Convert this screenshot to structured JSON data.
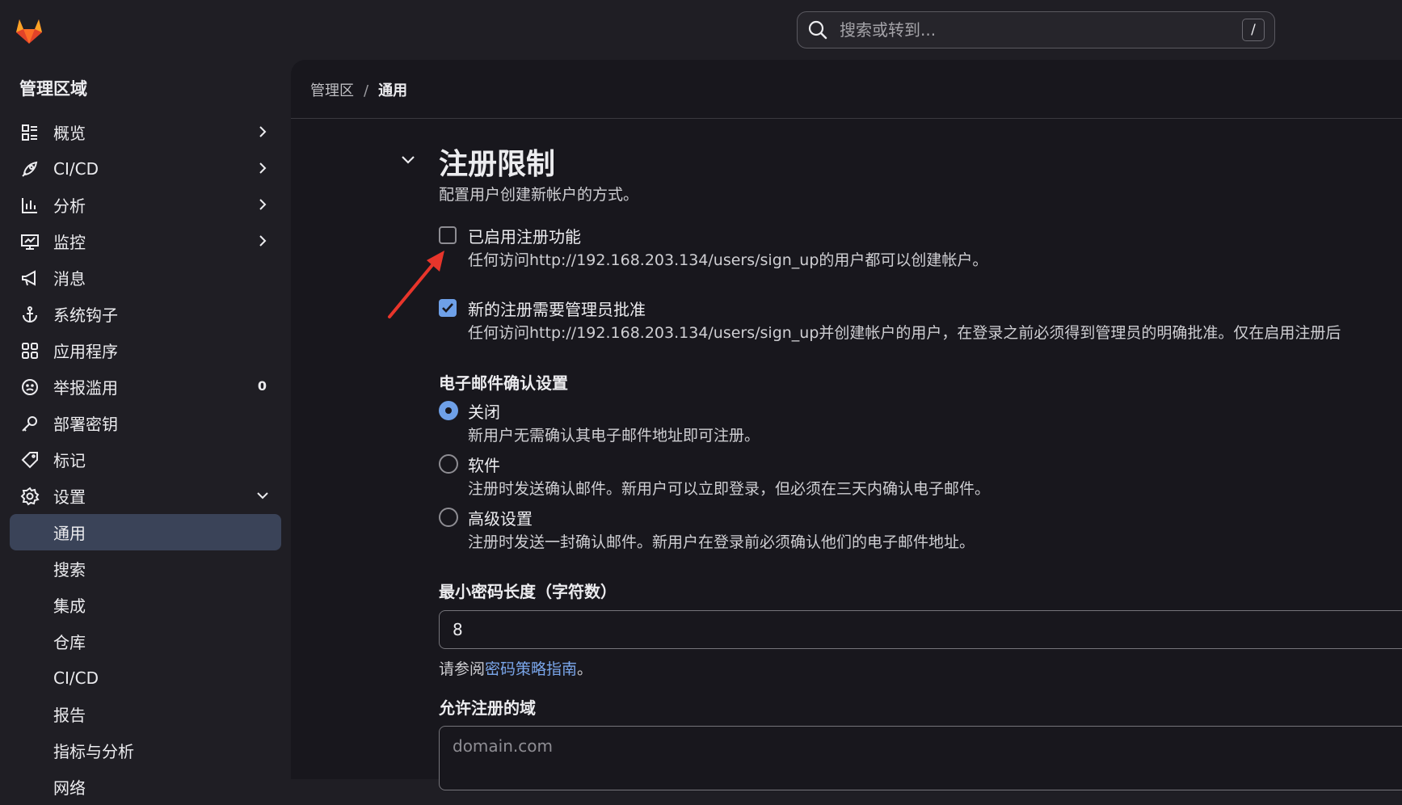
{
  "topbar": {
    "search_placeholder": "搜索或转到...",
    "search_shortcut": "/"
  },
  "sidebar": {
    "title": "管理区域",
    "items": [
      {
        "label": "概览",
        "icon": "overview-icon"
      },
      {
        "label": "CI/CD",
        "icon": "rocket-icon"
      },
      {
        "label": "分析",
        "icon": "chart-icon"
      },
      {
        "label": "监控",
        "icon": "monitor-icon"
      },
      {
        "label": "消息",
        "icon": "megaphone-icon"
      },
      {
        "label": "系统钩子",
        "icon": "anchor-icon"
      },
      {
        "label": "应用程序",
        "icon": "apps-icon"
      },
      {
        "label": "举报滥用",
        "icon": "abuse-icon",
        "count": "0"
      },
      {
        "label": "部署密钥",
        "icon": "key-icon"
      },
      {
        "label": "标记",
        "icon": "label-icon"
      },
      {
        "label": "设置",
        "icon": "gear-icon"
      }
    ],
    "subitems": [
      "通用",
      "搜索",
      "集成",
      "仓库",
      "CI/CD",
      "报告",
      "指标与分析",
      "网络"
    ]
  },
  "breadcrumb": {
    "root": "管理区",
    "separator": "/",
    "current": "通用"
  },
  "section": {
    "title": "注册限制",
    "description": "配置用户创建新帐户的方式。",
    "signup_enabled": {
      "label": "已启用注册功能",
      "help": "任何访问http://192.168.203.134/users/sign_up的用户都可以创建帐户。",
      "checked": false
    },
    "admin_approval": {
      "label": "新的注册需要管理员批准",
      "help": "任何访问http://192.168.203.134/users/sign_up并创建帐户的用户，在登录之前必须得到管理员的明确批准。仅在启用注册后",
      "checked": true
    },
    "email_confirm": {
      "heading": "电子邮件确认设置",
      "options": [
        {
          "label": "关闭",
          "help": "新用户无需确认其电子邮件地址即可注册。",
          "checked": true
        },
        {
          "label": "软件",
          "help": "注册时发送确认邮件。新用户可以立即登录，但必须在三天内确认电子邮件。",
          "checked": false
        },
        {
          "label": "高级设置",
          "help": "注册时发送一封确认邮件。新用户在登录前必须确认他们的电子邮件地址。",
          "checked": false
        }
      ]
    },
    "min_password": {
      "heading": "最小密码长度（字符数）",
      "value": "8",
      "help_prefix": "请参阅",
      "help_link": "密码策略指南",
      "help_suffix": "。"
    },
    "allowed_domains": {
      "heading": "允许注册的域",
      "placeholder": "domain.com"
    }
  },
  "colors": {
    "accent": "#6ea0e8",
    "annotation_arrow": "#e8352b",
    "active_nav": "#3a4358"
  }
}
